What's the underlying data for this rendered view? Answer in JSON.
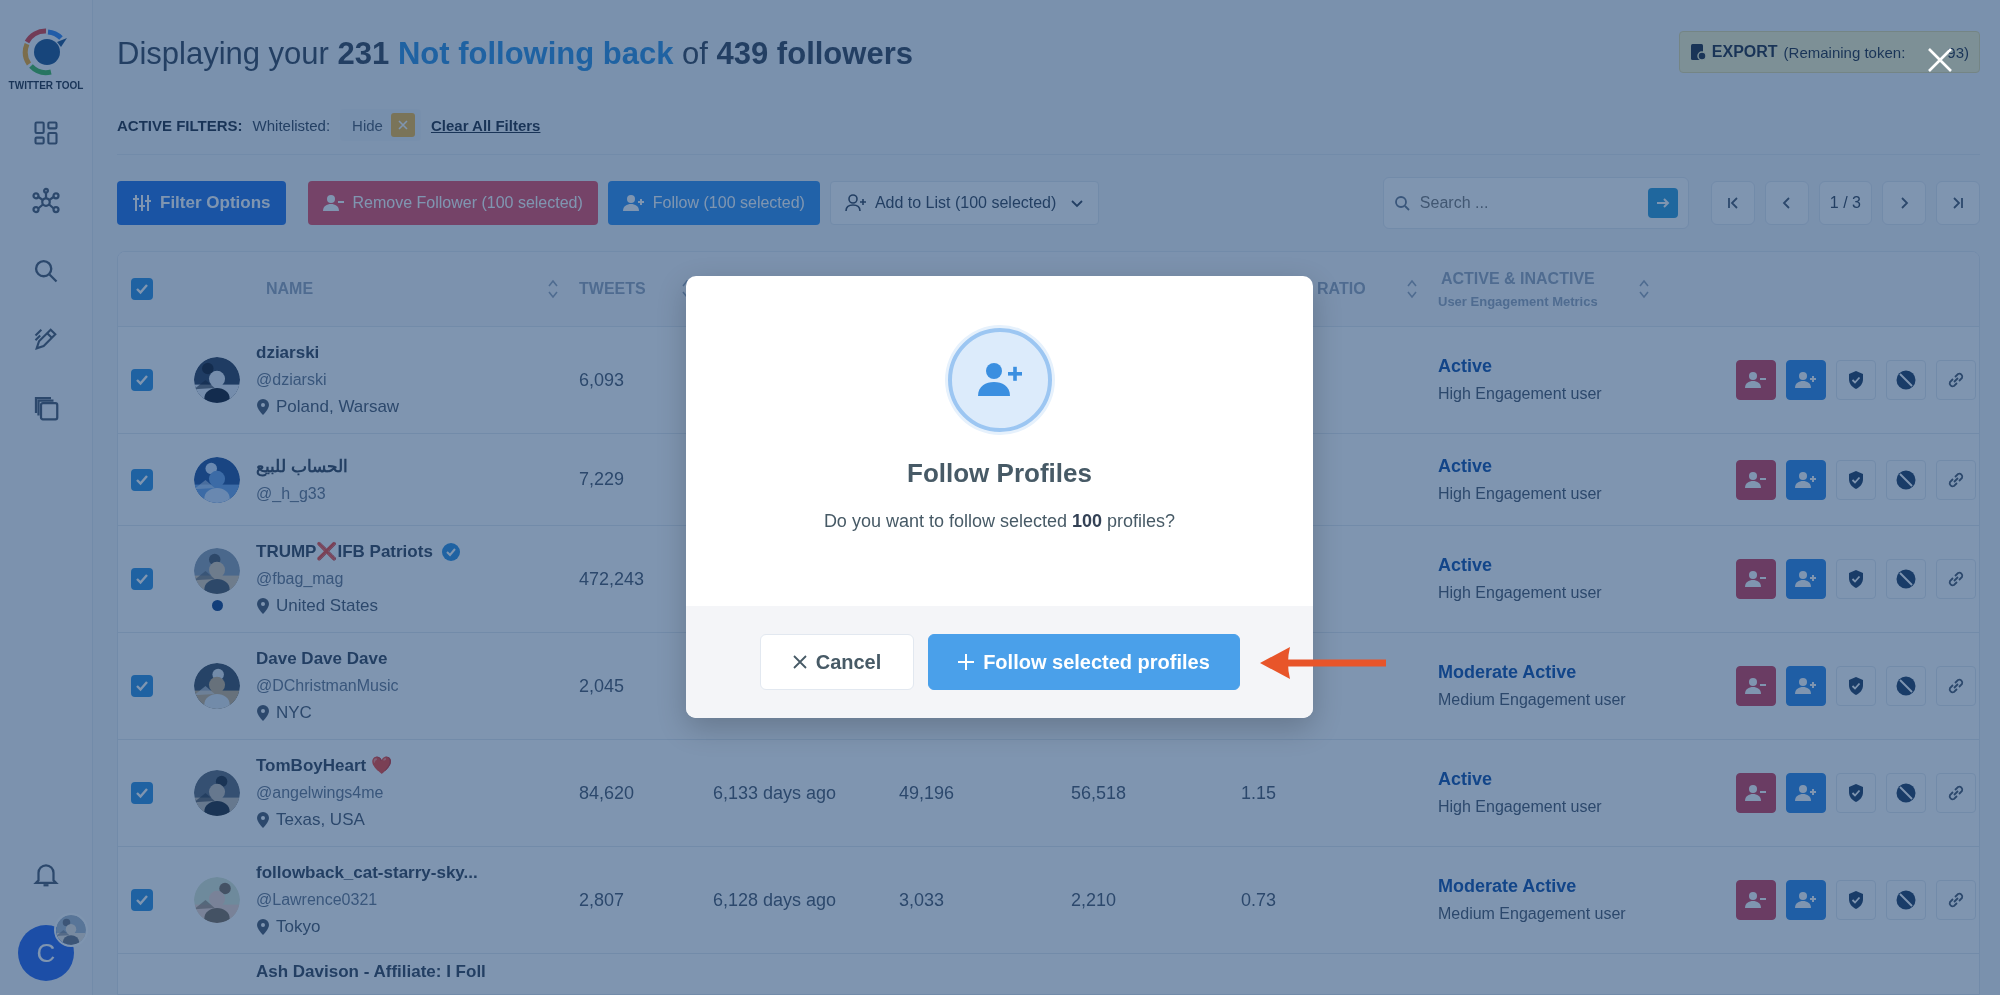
{
  "sidebar": {
    "logo_text": "TWITTER TOOL",
    "user_initial": "C"
  },
  "header": {
    "title_parts": [
      {
        "text": "Displaying your ",
        "kind": "plain"
      },
      {
        "text": "231 ",
        "kind": "strong"
      },
      {
        "text": "Not following back ",
        "kind": "accent"
      },
      {
        "text": "of ",
        "kind": "plain"
      },
      {
        "text": "439 followers",
        "kind": "strong"
      }
    ],
    "export": {
      "label": "EXPORT",
      "note": "(Remaining token:",
      "note_end": "93)"
    }
  },
  "filters": {
    "label": "ACTIVE FILTERS:",
    "name": "Whitelisted:",
    "chip": "Hide",
    "clear": "Clear All Filters"
  },
  "toolbar": {
    "buttons": [
      {
        "kind": "filter",
        "label": "Filter Options"
      },
      {
        "kind": "remove",
        "label": "Remove Follower (100 selected)"
      },
      {
        "kind": "follow",
        "label": "Follow (100 selected)"
      },
      {
        "kind": "list",
        "label": "Add to List (100 selected)"
      }
    ],
    "search": {
      "placeholder": "Search ..."
    },
    "page": "1 / 3"
  },
  "table": {
    "select_all": {
      "checked": true
    },
    "columns": [
      {
        "label": "NAME"
      },
      {
        "label": "TWEETS"
      },
      {
        "label": "RATIO"
      },
      {
        "label": "ACTIVE & INACTIVE",
        "sublabel": "User Engagement Metrics"
      }
    ],
    "rows": [
      {
        "checked": true,
        "name": "dziarski",
        "verified": false,
        "handle": "@dziarski",
        "location": "Poland, Warsaw",
        "status_dot": false,
        "tweets": "6,093",
        "status": "Active",
        "engagement": "High Engagement user"
      },
      {
        "checked": true,
        "name": "الحساب للبيع",
        "verified": false,
        "handle": "@_h_g33",
        "status_dot": false,
        "tweets": "7,229",
        "status": "Active",
        "engagement": "High Engagement user"
      },
      {
        "checked": true,
        "name": "TRUMP❌IFB Patriots",
        "verified": true,
        "handle": "@fbag_mag",
        "location": "United States",
        "status_dot": true,
        "tweets": "472,243",
        "status": "Active",
        "engagement": "High Engagement user"
      },
      {
        "checked": true,
        "name": "Dave Dave Dave",
        "verified": false,
        "handle": "@DChristmanMusic",
        "location": "NYC",
        "status_dot": false,
        "tweets": "2,045",
        "status": "Moderate Active",
        "engagement": "Medium Engagement user"
      },
      {
        "checked": true,
        "name": "TomBoyHeart ❤️",
        "verified": false,
        "handle": "@angelwings4me",
        "location": "Texas, USA",
        "status_dot": false,
        "tweets": "84,620",
        "column_3": "6,133 days ago",
        "column_4": "49,196",
        "column_5": "56,518",
        "ratio": "1.15",
        "status": "Active",
        "engagement": "High Engagement user"
      },
      {
        "checked": true,
        "name": "followback_cat-starry-sky...",
        "verified": false,
        "handle": "@Lawrence0321",
        "location": "Tokyo",
        "status_dot": false,
        "tweets": "2,807",
        "column_3": "6,128 days ago",
        "column_4": "3,033",
        "column_5": "2,210",
        "ratio": "0.73",
        "status": "Moderate Active",
        "engagement": "Medium Engagement user"
      }
    ],
    "partial_row": {
      "name": "Ash Davison - Affiliate: I Foll"
    }
  },
  "modal": {
    "title": "Follow Profiles",
    "message": "Do you want to follow selected **100** profiles?",
    "cancel": "Cancel",
    "confirm": "Follow selected profiles"
  }
}
